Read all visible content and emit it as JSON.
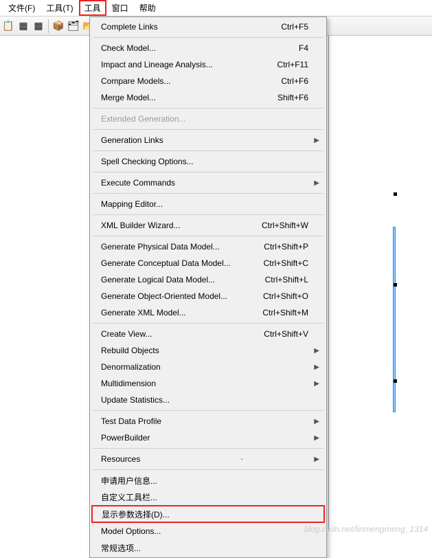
{
  "menubar": {
    "items": [
      {
        "label": "文件(F)"
      },
      {
        "label": "工具(T)"
      },
      {
        "label": "工具",
        "selected": true
      },
      {
        "label": "窗口"
      },
      {
        "label": "帮助"
      }
    ]
  },
  "toolbar": {
    "icons": [
      "📋",
      "▦",
      "▦",
      "",
      "📦",
      "🗂",
      "📂",
      "📂"
    ]
  },
  "menu": {
    "groups": [
      [
        {
          "label": "Complete Links",
          "shortcut": "Ctrl+F5"
        }
      ],
      [
        {
          "label": "Check Model...",
          "shortcut": "F4"
        },
        {
          "label": "Impact and Lineage Analysis...",
          "shortcut": "Ctrl+F11"
        },
        {
          "label": "Compare Models...",
          "shortcut": "Ctrl+F6"
        },
        {
          "label": "Merge Model...",
          "shortcut": "Shift+F6"
        }
      ],
      [
        {
          "label": "Extended Generation...",
          "disabled": true
        }
      ],
      [
        {
          "label": "Generation Links",
          "submenu": true
        }
      ],
      [
        {
          "label": "Spell Checking Options..."
        }
      ],
      [
        {
          "label": "Execute Commands",
          "submenu": true
        }
      ],
      [
        {
          "label": "Mapping Editor..."
        }
      ],
      [
        {
          "label": "XML Builder Wizard...",
          "shortcut": "Ctrl+Shift+W"
        }
      ],
      [
        {
          "label": "Generate Physical Data Model...",
          "shortcut": "Ctrl+Shift+P"
        },
        {
          "label": "Generate Conceptual Data Model...",
          "shortcut": "Ctrl+Shift+C"
        },
        {
          "label": "Generate Logical Data Model...",
          "shortcut": "Ctrl+Shift+L"
        },
        {
          "label": "Generate Object-Oriented Model...",
          "shortcut": "Ctrl+Shift+O"
        },
        {
          "label": "Generate XML Model...",
          "shortcut": "Ctrl+Shift+M"
        }
      ],
      [
        {
          "label": "Create View...",
          "shortcut": "Ctrl+Shift+V"
        },
        {
          "label": "Rebuild Objects",
          "submenu": true
        },
        {
          "label": "Denormalization",
          "submenu": true
        },
        {
          "label": "Multidimension",
          "submenu": true
        },
        {
          "label": "Update Statistics..."
        }
      ],
      [
        {
          "label": "Test Data Profile",
          "submenu": true
        },
        {
          "label": "PowerBuilder",
          "submenu": true
        }
      ],
      [
        {
          "label": "Resources",
          "submenu": true
        }
      ],
      [
        {
          "label": "申请用户信息..."
        },
        {
          "label": "自定义工具栏..."
        },
        {
          "label": "显示参数选择(D)...",
          "highlight": true
        },
        {
          "label": "Model Options..."
        },
        {
          "label": "常规选项..."
        }
      ]
    ]
  },
  "watermark": "blog.csdn.net/linmengmeng_1314"
}
